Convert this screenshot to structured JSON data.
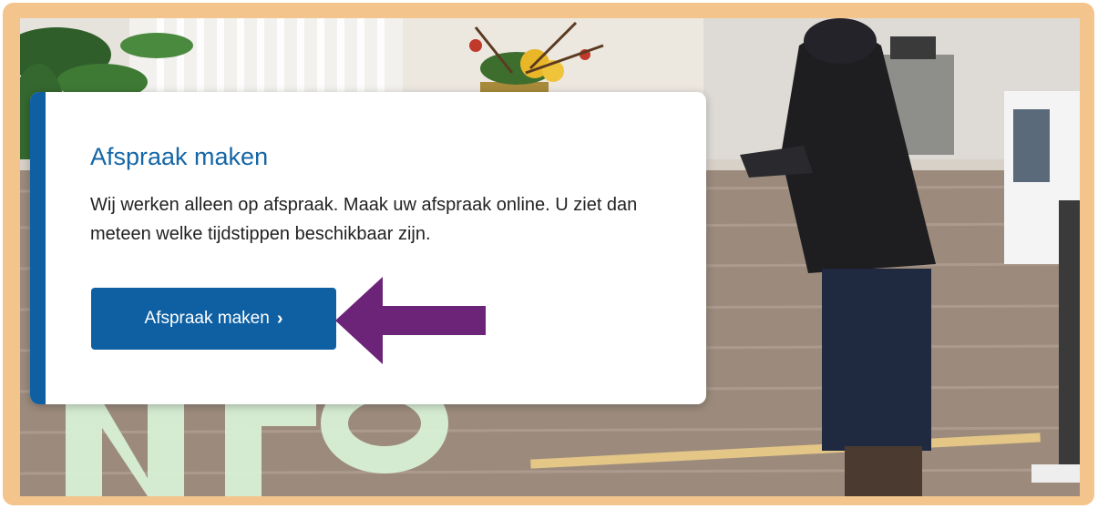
{
  "card": {
    "title": "Afspraak maken",
    "text": "Wij werken alleen op afspraak. Maak uw afspraak online. U ziet dan meteen welke tijdstippen beschikbaar zijn.",
    "button_label": "Afspraak maken",
    "button_chevron": "›"
  },
  "colors": {
    "frame": "#f3c48c",
    "accent": "#0e60a3",
    "title": "#1566a6",
    "arrow": "#6b2477"
  },
  "icons": {
    "arrow": "left-arrow-annotation",
    "chevron": "chevron-right-icon"
  }
}
